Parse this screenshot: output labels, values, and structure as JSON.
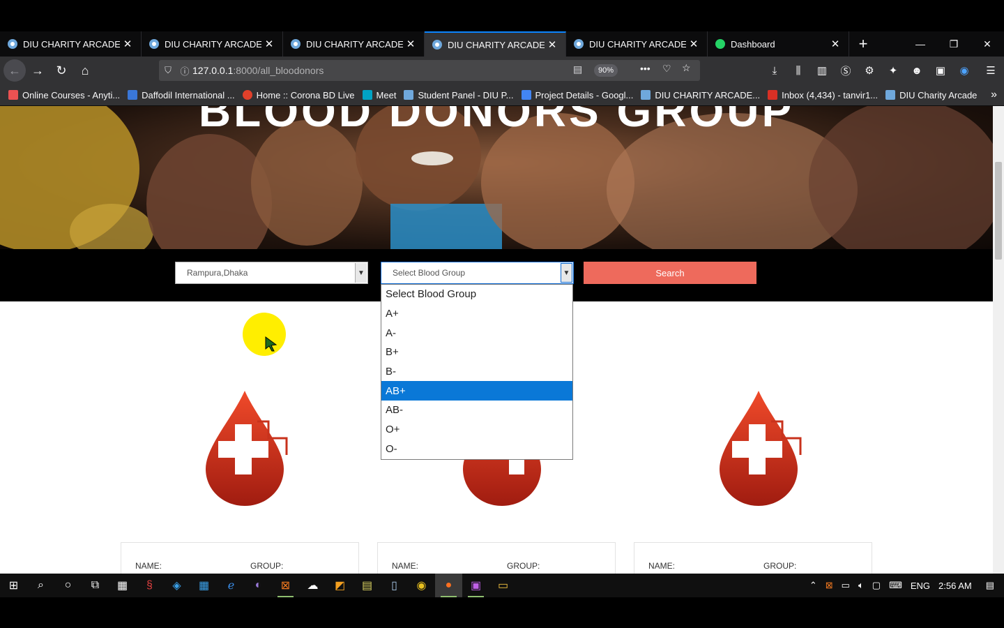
{
  "browser": {
    "tabs": [
      {
        "title": "DIU CHARITY ARCADE",
        "active": false
      },
      {
        "title": "DIU CHARITY ARCADE",
        "active": false
      },
      {
        "title": "DIU CHARITY ARCADE",
        "active": false
      },
      {
        "title": "DIU CHARITY ARCADE",
        "active": true
      },
      {
        "title": "DIU CHARITY ARCADE",
        "active": false
      },
      {
        "title": "Dashboard",
        "active": false
      }
    ],
    "url_host": "127.0.0.1",
    "url_path": ":8000/all_bloodonors",
    "zoom": "90%",
    "bookmarks": [
      "Online Courses - Anyti...",
      "Daffodil International ...",
      "Home :: Corona BD Live",
      "Meet",
      "Student Panel - DIU P...",
      "Project Details - Googl...",
      "DIU CHARITY ARCADE...",
      "Inbox (4,434) - tanvir1...",
      "DIU Charity Arcade"
    ]
  },
  "page": {
    "hero_title": "BLOOD DONORS GROUP",
    "location_select": "Rampura,Dhaka",
    "blood_select": "Select Blood Group",
    "search_button": "Search",
    "dropdown_options": [
      "Select Blood Group",
      "A+",
      "A-",
      "B+",
      "B-",
      "AB+",
      "AB-",
      "O+",
      "O-"
    ],
    "highlighted_option": "AB+",
    "cards": [
      {
        "name_label": "NAME:",
        "group_label": "GROUP:"
      },
      {
        "name_label": "NAME:",
        "group_label": "GROUP:"
      },
      {
        "name_label": "NAME:",
        "group_label": "GROUP:"
      }
    ]
  },
  "taskbar": {
    "language": "ENG",
    "time": "2:56 AM"
  },
  "colors": {
    "search_button": "#ee6a5c",
    "dropdown_highlight": "#0a78d7",
    "drop_red": "#c8321c"
  }
}
